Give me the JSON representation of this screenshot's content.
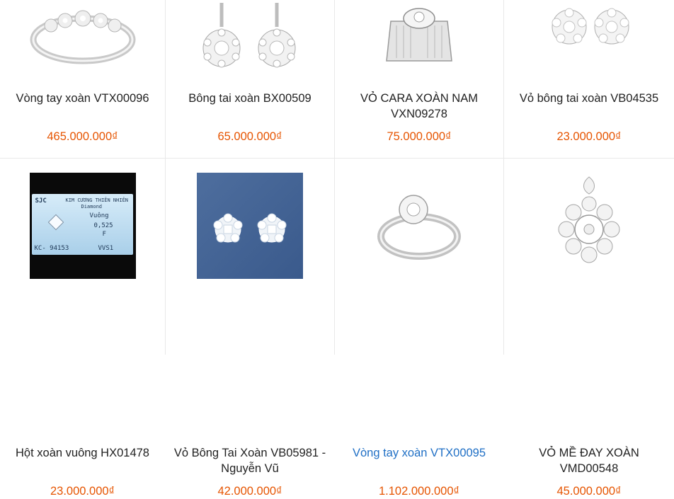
{
  "products": [
    {
      "name": "Vòng tay xoàn VTX00096",
      "price": "465.000.000₫",
      "image_icon": "bracelet-icon"
    },
    {
      "name": "Bông tai xoàn BX00509",
      "price": "65.000.000₫",
      "image_icon": "drop-earrings-icon"
    },
    {
      "name": "VỎ CARA XOÀN NAM VXN09278",
      "price": "75.000.000₫",
      "image_icon": "mens-ring-icon"
    },
    {
      "name": "Vỏ bông tai xoàn VB04535",
      "price": "23.000.000₫",
      "image_icon": "flower-earrings-icon"
    },
    {
      "name": "Hột xoàn vuông HX01478",
      "price": "23.000.000₫",
      "image_icon": "diamond-certificate-icon",
      "certificate": {
        "brand": "SJC",
        "title": "KIM CƯƠNG THIÊN NHIÊN",
        "subtitle": "Diamond",
        "shape": "Vuông",
        "weight": "0,525",
        "color": "F",
        "code": "KC- 94153",
        "clarity": "VVS1"
      }
    },
    {
      "name": "Vỏ Bông Tai Xoàn VB05981 - Nguyễn Vũ",
      "price": "42.000.000₫",
      "image_icon": "stud-earrings-icon"
    },
    {
      "name": "Vòng tay xoàn VTX00095",
      "price": "1.102.000.000₫",
      "image_icon": "ring-icon",
      "highlighted": true
    },
    {
      "name": "VỎ MỀ ĐAY XOÀN VMD00548",
      "price": "45.000.000₫",
      "image_icon": "pendant-icon"
    }
  ],
  "colors": {
    "price": "#e65400",
    "link_hover": "#1f6fc5",
    "text": "#222222",
    "divider": "#e8e8e8"
  }
}
